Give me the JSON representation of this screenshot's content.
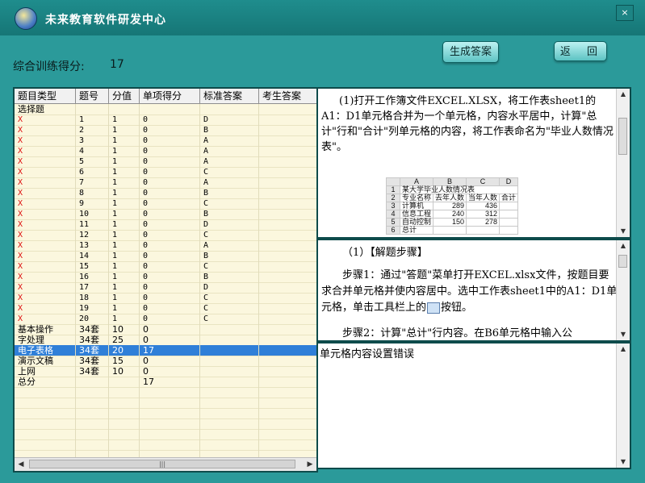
{
  "window": {
    "title": "未来教育软件研发中心",
    "close_label": "×"
  },
  "score": {
    "label": "综合训练得分:",
    "value": "17"
  },
  "buttons": {
    "generate": "生成答案",
    "back": "返 回"
  },
  "table": {
    "columns": [
      "题目类型",
      "题号",
      "分值",
      "单项得分",
      "标准答案",
      "考生答案"
    ],
    "rows": [
      {
        "type": "选择题",
        "num": "",
        "score": "",
        "got": "",
        "std": "",
        "ans": "",
        "mark": false
      },
      {
        "type": "X",
        "num": "1",
        "score": "1",
        "got": "0",
        "std": "D",
        "ans": "",
        "mark": true
      },
      {
        "type": "X",
        "num": "2",
        "score": "1",
        "got": "0",
        "std": "B",
        "ans": "",
        "mark": true
      },
      {
        "type": "X",
        "num": "3",
        "score": "1",
        "got": "0",
        "std": "A",
        "ans": "",
        "mark": true
      },
      {
        "type": "X",
        "num": "4",
        "score": "1",
        "got": "0",
        "std": "A",
        "ans": "",
        "mark": true
      },
      {
        "type": "X",
        "num": "5",
        "score": "1",
        "got": "0",
        "std": "A",
        "ans": "",
        "mark": true
      },
      {
        "type": "X",
        "num": "6",
        "score": "1",
        "got": "0",
        "std": "C",
        "ans": "",
        "mark": true
      },
      {
        "type": "X",
        "num": "7",
        "score": "1",
        "got": "0",
        "std": "A",
        "ans": "",
        "mark": true
      },
      {
        "type": "X",
        "num": "8",
        "score": "1",
        "got": "0",
        "std": "B",
        "ans": "",
        "mark": true
      },
      {
        "type": "X",
        "num": "9",
        "score": "1",
        "got": "0",
        "std": "C",
        "ans": "",
        "mark": true
      },
      {
        "type": "X",
        "num": "10",
        "score": "1",
        "got": "0",
        "std": "B",
        "ans": "",
        "mark": true
      },
      {
        "type": "X",
        "num": "11",
        "score": "1",
        "got": "0",
        "std": "D",
        "ans": "",
        "mark": true
      },
      {
        "type": "X",
        "num": "12",
        "score": "1",
        "got": "0",
        "std": "C",
        "ans": "",
        "mark": true
      },
      {
        "type": "X",
        "num": "13",
        "score": "1",
        "got": "0",
        "std": "A",
        "ans": "",
        "mark": true
      },
      {
        "type": "X",
        "num": "14",
        "score": "1",
        "got": "0",
        "std": "B",
        "ans": "",
        "mark": true
      },
      {
        "type": "X",
        "num": "15",
        "score": "1",
        "got": "0",
        "std": "C",
        "ans": "",
        "mark": true
      },
      {
        "type": "X",
        "num": "16",
        "score": "1",
        "got": "0",
        "std": "B",
        "ans": "",
        "mark": true
      },
      {
        "type": "X",
        "num": "17",
        "score": "1",
        "got": "0",
        "std": "D",
        "ans": "",
        "mark": true
      },
      {
        "type": "X",
        "num": "18",
        "score": "1",
        "got": "0",
        "std": "C",
        "ans": "",
        "mark": true
      },
      {
        "type": "X",
        "num": "19",
        "score": "1",
        "got": "0",
        "std": "C",
        "ans": "",
        "mark": true
      },
      {
        "type": "X",
        "num": "20",
        "score": "1",
        "got": "0",
        "std": "C",
        "ans": "",
        "mark": true
      },
      {
        "type": "基本操作",
        "num": "34套",
        "score": "10",
        "got": "0",
        "std": "",
        "ans": "",
        "mark": false
      },
      {
        "type": "字处理",
        "num": "34套",
        "score": "25",
        "got": "0",
        "std": "",
        "ans": "",
        "mark": false
      },
      {
        "type": "电子表格",
        "num": "34套",
        "score": "20",
        "got": "17",
        "std": "",
        "ans": "",
        "mark": false,
        "selected": true
      },
      {
        "type": "演示文稿",
        "num": "34套",
        "score": "15",
        "got": "0",
        "std": "",
        "ans": "",
        "mark": false
      },
      {
        "type": "上网",
        "num": "34套",
        "score": "10",
        "got": "0",
        "std": "",
        "ans": "",
        "mark": false
      },
      {
        "type": "总分",
        "num": "",
        "score": "",
        "got": "17",
        "std": "",
        "ans": "",
        "mark": false
      }
    ],
    "scroll_thumb_glyph": "|||"
  },
  "question": {
    "text": "(1)打开工作簿文件EXCEL.XLSX，将工作表sheet1的A1：D1单元格合并为一个单元格，内容水平居中，计算\"总计\"行和\"合计\"列单元格的内容，将工作表命名为\"毕业人数情况表\"。",
    "sheet": {
      "col_headers": [
        "A",
        "B",
        "C",
        "D"
      ],
      "rows": [
        [
          "1",
          "某大学毕业人数情况表",
          "",
          "",
          ""
        ],
        [
          "2",
          "专业名称",
          "去年人数",
          "当年人数",
          "合计"
        ],
        [
          "3",
          "计算机",
          "289",
          "436",
          ""
        ],
        [
          "4",
          "信息工程",
          "240",
          "312",
          ""
        ],
        [
          "5",
          "自动控制",
          "150",
          "278",
          ""
        ],
        [
          "6",
          "总计",
          "",
          "",
          ""
        ]
      ]
    }
  },
  "solution": {
    "title": "（1）【解题步骤】",
    "step1_a": "步骤1：通过\"答题\"菜单打开EXCEL.xlsx文件，按题目要求合并单元格并使内容居中。选中工作表sheet1中的A1：D1单元格，单击工具栏上的",
    "step1_b": "按钮。",
    "step2": "步骤2：计算\"总计\"行内容。在B6单元格中输入公"
  },
  "result": {
    "text": "单元格内容设置错误"
  },
  "colors": {
    "accent": "#2b9a9a",
    "selected_row": "#2f7fd8",
    "wrong_mark": "#dd1111"
  }
}
